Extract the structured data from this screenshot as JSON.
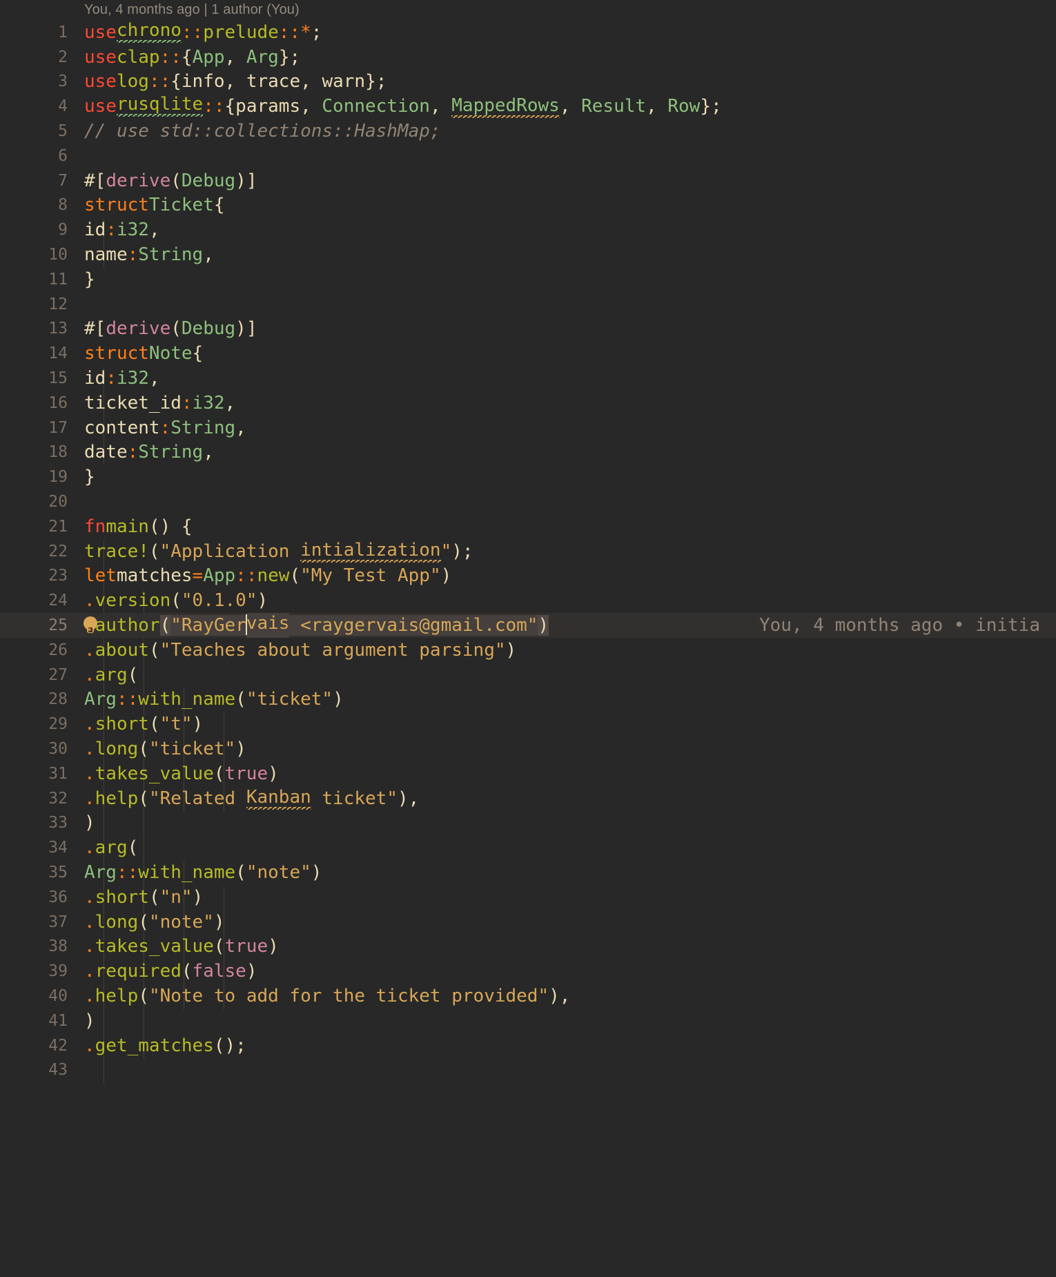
{
  "editor": {
    "theme_name": "gruvbox-dark",
    "background": "#282828",
    "current_line_background": "#32302f",
    "foreground": "#ebdbb2",
    "linenumber_color": "#7c6f64",
    "language": "rust",
    "first_visible_line": 1,
    "last_visible_line": 43
  },
  "blame_header": {
    "text": "You, 4 months ago | 1 author (You)"
  },
  "current_line": {
    "number": 25,
    "gutter_icon": "lightbulb-icon",
    "blame_annotation": "You, 4 months ago • initia",
    "blame_annotation_truncated": true
  },
  "lines": [
    {
      "n": 1,
      "text": "use chrono::prelude::*;"
    },
    {
      "n": 2,
      "text": "use clap::{App, Arg};"
    },
    {
      "n": 3,
      "text": "use log::{info, trace, warn};"
    },
    {
      "n": 4,
      "text": "use rusqlite::{params, Connection, MappedRows, Result, Row};"
    },
    {
      "n": 5,
      "text": "// use std::collections::HashMap;"
    },
    {
      "n": 6,
      "text": ""
    },
    {
      "n": 7,
      "text": "#[derive(Debug)]"
    },
    {
      "n": 8,
      "text": "struct Ticket {"
    },
    {
      "n": 9,
      "text": "    id: i32,"
    },
    {
      "n": 10,
      "text": "    name: String,"
    },
    {
      "n": 11,
      "text": "}"
    },
    {
      "n": 12,
      "text": ""
    },
    {
      "n": 13,
      "text": "#[derive(Debug)]"
    },
    {
      "n": 14,
      "text": "struct Note {"
    },
    {
      "n": 15,
      "text": "    id: i32,"
    },
    {
      "n": 16,
      "text": "    ticket_id: i32,"
    },
    {
      "n": 17,
      "text": "    content: String,"
    },
    {
      "n": 18,
      "text": "    date: String,"
    },
    {
      "n": 19,
      "text": "}"
    },
    {
      "n": 20,
      "text": ""
    },
    {
      "n": 21,
      "text": "fn main() {"
    },
    {
      "n": 22,
      "text": "    trace!(\"Application intialization\");"
    },
    {
      "n": 23,
      "text": "    let matches = App::new(\"My Test App\")"
    },
    {
      "n": 24,
      "text": "        .version(\"0.1.0\")"
    },
    {
      "n": 25,
      "text": "        .author(\"RayGervais <raygervais@gmail.com\")"
    },
    {
      "n": 26,
      "text": "        .about(\"Teaches about argument parsing\")"
    },
    {
      "n": 27,
      "text": "        .arg("
    },
    {
      "n": 28,
      "text": "            Arg::with_name(\"ticket\")"
    },
    {
      "n": 29,
      "text": "                .short(\"t\")"
    },
    {
      "n": 30,
      "text": "                .long(\"ticket\")"
    },
    {
      "n": 31,
      "text": "                .takes_value(true)"
    },
    {
      "n": 32,
      "text": "                .help(\"Related Kanban ticket\"),"
    },
    {
      "n": 33,
      "text": "        )"
    },
    {
      "n": 34,
      "text": "        .arg("
    },
    {
      "n": 35,
      "text": "            Arg::with_name(\"note\")"
    },
    {
      "n": 36,
      "text": "                .short(\"n\")"
    },
    {
      "n": 37,
      "text": "                .long(\"note\")"
    },
    {
      "n": 38,
      "text": "                .takes_value(true)"
    },
    {
      "n": 39,
      "text": "                .required(false)"
    },
    {
      "n": 40,
      "text": "                .help(\"Note to add for the ticket provided\"),"
    },
    {
      "n": 41,
      "text": "        )"
    },
    {
      "n": 42,
      "text": "        .get_matches();"
    },
    {
      "n": 43,
      "text": ""
    }
  ],
  "diagnostics": [
    {
      "line": 1,
      "word": "chrono",
      "kind": "spelling",
      "color": "#8ec07c"
    },
    {
      "line": 4,
      "word": "rusqlite",
      "kind": "spelling",
      "color": "#8ec07c"
    },
    {
      "line": 4,
      "word": "MappedRows",
      "kind": "spelling",
      "color": "#d8a657"
    },
    {
      "line": 22,
      "word": "intialization",
      "kind": "spelling",
      "color": "#d8a657"
    },
    {
      "line": 25,
      "word": "Gervais",
      "kind": "spelling",
      "color": "#8ec07c"
    },
    {
      "line": 32,
      "word": "Kanban",
      "kind": "spelling",
      "color": "#d8a657"
    }
  ],
  "syntax_colors": {
    "keyword": "#fb4934",
    "keyword_alt": "#fe8019",
    "module": "#b8bb26",
    "type": "#8ec07c",
    "string": "#d8a657",
    "comment": "#928374",
    "attribute": "#d3869b",
    "operator": "#fe8019",
    "identifier": "#ebdbb2"
  }
}
